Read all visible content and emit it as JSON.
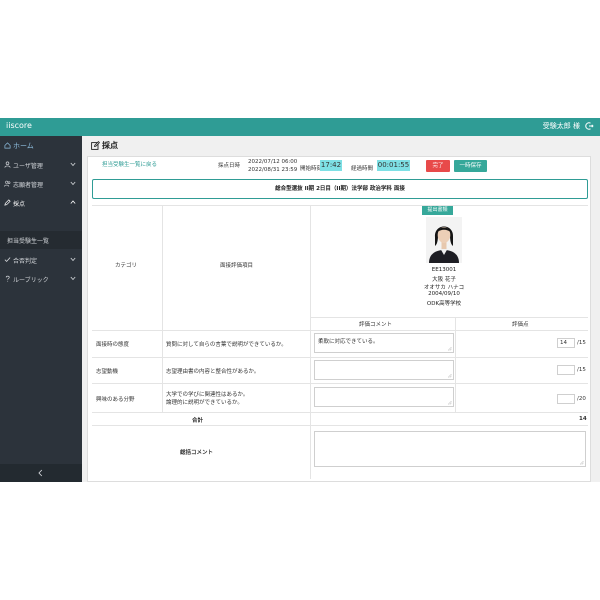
{
  "app": {
    "title": "iiscore",
    "user": "受験太郎 様"
  },
  "sidebar": {
    "items": [
      {
        "label": "ホーム",
        "icon": "home-icon"
      },
      {
        "label": "ユーザ管理",
        "icon": "user-icon"
      },
      {
        "label": "志願者管理",
        "icon": "users-icon"
      },
      {
        "label": "採点",
        "icon": "pencil-icon"
      },
      {
        "label": "合否判定",
        "icon": "check-icon"
      },
      {
        "label": "ルーブリック",
        "icon": "question-icon"
      }
    ],
    "subitem": "担当受験生一覧"
  },
  "page": {
    "title": "採点",
    "back_link": "担当受験生一覧に戻る",
    "date_label": "採点日時",
    "date_start": "2022/07/12 06:00",
    "date_end": "2022/08/31 23:59",
    "start_label": "開始時刻",
    "start_time": "17:42",
    "elapsed_label": "経過時間",
    "elapsed_time": "00:01:55",
    "complete_label": "完了",
    "save_label": "一時保存"
  },
  "exam": {
    "header": "総合型選抜 II期 2日目（II期）法学部 政治学科 面接"
  },
  "table": {
    "category_header": "カテゴリ",
    "criteria_header": "面接評価項目",
    "comment_header": "評価コメント",
    "score_header": "評価点",
    "docs_badge": "提出書類",
    "applicant": {
      "id": "EE13001",
      "name": "大阪 花子",
      "kana": "オオサカ ハナコ",
      "birthdate": "2004/09/10",
      "school": "ODK高等学校"
    },
    "rows": [
      {
        "category": "面接時の態度",
        "criteria": "質問に対して自らの言葉で説明ができているか。",
        "comment": "柔軟に対応できている。",
        "score": "14",
        "max": "/15"
      },
      {
        "category": "志望動機",
        "criteria": "志望理由書の内容と整合性があるか。",
        "comment": "",
        "score": "",
        "max": "/15"
      },
      {
        "category": "興味のある分野",
        "criteria": "大学での学びに関連性はあるか。",
        "criteria2": "論理的に説明ができているか。",
        "comment": "",
        "score": "",
        "max": "/20"
      }
    ],
    "total_label": "合計",
    "total_value": "14",
    "overall_label": "総括コメント"
  }
}
